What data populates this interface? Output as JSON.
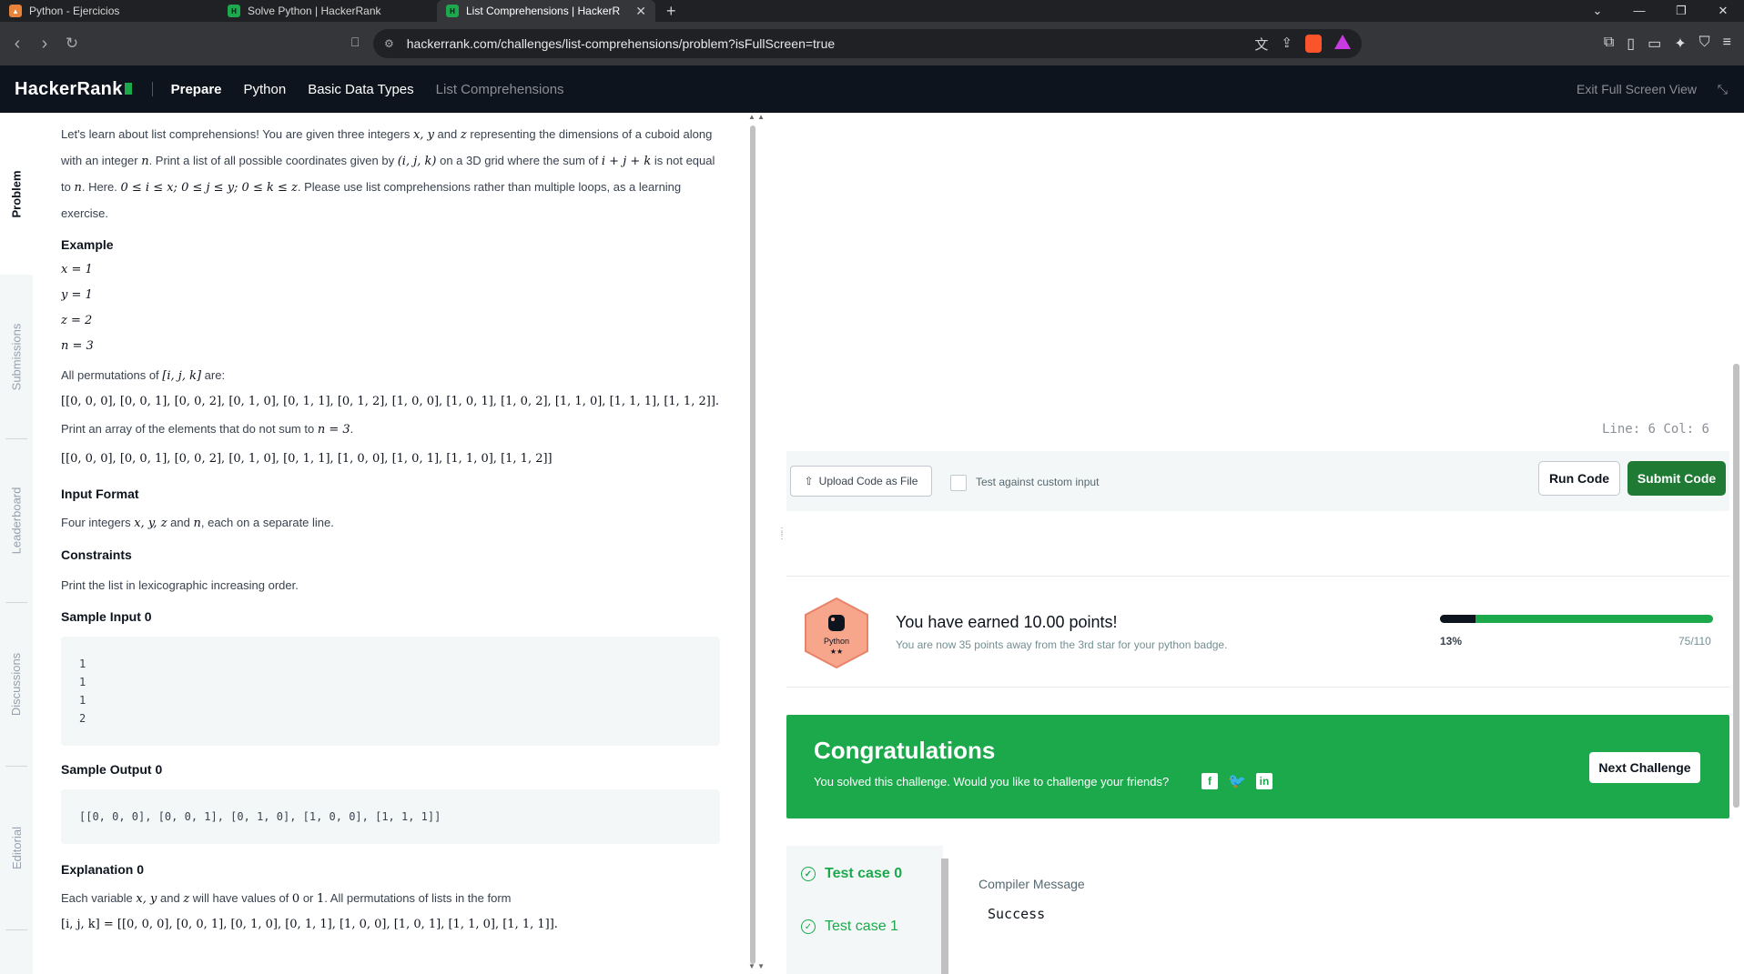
{
  "browser": {
    "tabs": [
      {
        "title": "Python - Ejercicios",
        "active": false
      },
      {
        "title": "Solve Python | HackerRank",
        "active": false
      },
      {
        "title": "List Comprehensions | HackerR",
        "active": true
      }
    ],
    "url": "hackerrank.com/challenges/list-comprehensions/problem?isFullScreen=true"
  },
  "header": {
    "logo": "HackerRank",
    "breadcrumbs": [
      "Prepare",
      "Python",
      "Basic Data Types",
      "List Comprehensions"
    ],
    "exit_fullscreen": "Exit Full Screen View"
  },
  "side_tabs": [
    "Problem",
    "Submissions",
    "Leaderboard",
    "Discussions",
    "Editorial"
  ],
  "problem": {
    "intro": [
      "Let's learn about list comprehensions! You are given three integers",
      "x, y",
      "and",
      "z",
      "representing the dimensions of a cuboid along with an integer",
      "n",
      ". Print a list of all possible coordinates given by",
      "(i, j, k)",
      "on a 3D grid where the sum of",
      "i + j + k",
      "is not equal to",
      "n",
      ". Here.",
      "0 ≤ i ≤ x; 0 ≤ j ≤ y; 0 ≤ k ≤ z",
      ". Please use list comprehensions rather than multiple loops, as a learning exercise."
    ],
    "example_heading": "Example",
    "example_vars": [
      "x = 1",
      "y = 1",
      "z = 2",
      "n = 3"
    ],
    "perm_text": "All permutations of",
    "perm_var": "[i, j, k]",
    "perm_are": "are:",
    "perm_list": "[[0, 0, 0], [0, 0, 1], [0, 0, 2], [0, 1, 0], [0, 1, 1], [0, 1, 2], [1, 0, 0], [1, 0, 1], [1, 0, 2], [1, 1, 0], [1, 1, 1], [1, 1, 2]].",
    "print_text": "Print an array of the elements that do not sum to",
    "print_var": "n = 3",
    "result_list": "[[0, 0, 0], [0, 0, 1], [0, 0, 2], [0, 1, 0], [0, 1, 1], [1, 0, 0], [1, 0, 1], [1, 1, 0], [1, 1, 2]]",
    "input_format_heading": "Input Format",
    "input_format_text": "Four integers",
    "input_format_vars": "x, y, z",
    "input_format_and": "and",
    "input_format_n": "n",
    "input_format_tail": ", each on a separate line.",
    "constraints_heading": "Constraints",
    "constraints_text": "Print the list in lexicographic increasing order.",
    "sample_input_heading": "Sample Input 0",
    "sample_input": [
      "1",
      "1",
      "1",
      "2"
    ],
    "sample_output_heading": "Sample Output 0",
    "sample_output": "[[0, 0, 0], [0, 0, 1], [0, 1, 0], [1, 0, 0], [1, 1, 1]]",
    "explanation_heading": "Explanation 0",
    "explanation_text": "Each variable",
    "explanation_vars": "x, y",
    "explanation_and": "and",
    "explanation_z": "z",
    "explanation_tail": "will have values of",
    "explanation_zero": "0",
    "explanation_or": "or",
    "explanation_one": "1",
    "explanation_tail2": ". All permutations of lists in the form",
    "explanation_list": "[i, j, k] = [[0, 0, 0], [0, 0, 1], [0, 1, 0], [0, 1, 1], [1, 0, 0], [1, 0, 1], [1, 1, 0], [1, 1, 1]]."
  },
  "editor": {
    "line_col": "Line: 6 Col: 6"
  },
  "toolbar": {
    "upload_label": "Upload Code as File",
    "custom_input_label": "Test against custom input",
    "run_label": "Run Code",
    "submit_label": "Submit Code"
  },
  "points": {
    "badge_label": "Python",
    "title": "You have earned 10.00 points!",
    "subtitle": "You are now 35 points away from the 3rd star for your python badge.",
    "progress_pct": "13%",
    "progress_value": 0.13,
    "progress_fraction": "75/110"
  },
  "congrats": {
    "title": "Congratulations",
    "subtitle": "You solved this challenge. Would you like to challenge your friends?",
    "next_label": "Next Challenge"
  },
  "testcases": [
    {
      "label": "Test case 0",
      "active": true
    },
    {
      "label": "Test case 1",
      "active": false
    }
  ],
  "result": {
    "compiler_label": "Compiler Message",
    "message": "Success"
  },
  "colors": {
    "brand_green": "#1ba94c",
    "dark": "#0e141e",
    "submit_green": "#1f7a34"
  }
}
